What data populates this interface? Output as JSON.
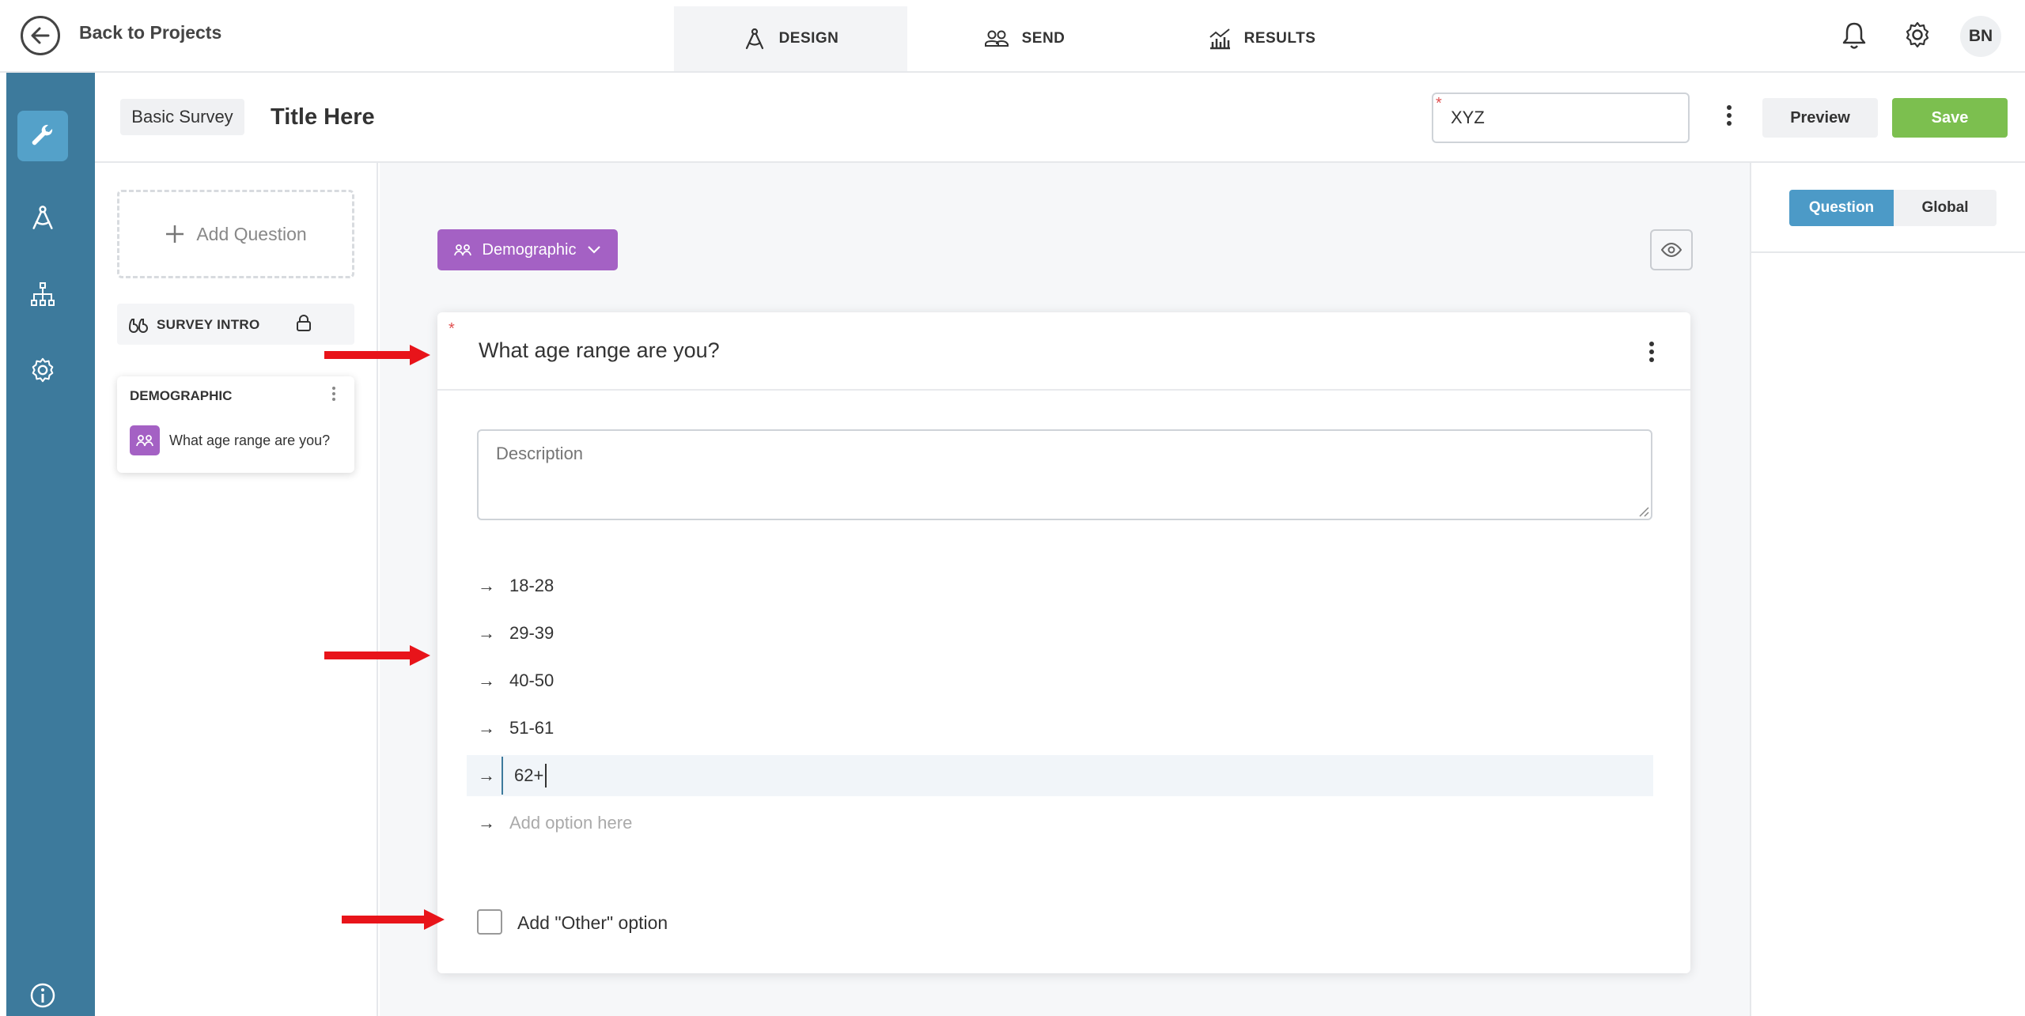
{
  "header": {
    "back_label": "Back to Projects",
    "tabs": [
      {
        "label": "DESIGN",
        "icon": "compass-icon",
        "active": true
      },
      {
        "label": "SEND",
        "icon": "users-icon",
        "active": false
      },
      {
        "label": "RESULTS",
        "icon": "chart-icon",
        "active": false
      }
    ],
    "avatar_initials": "BN"
  },
  "rail": {
    "items": [
      "wrench-icon",
      "compass-icon",
      "sitemap-icon",
      "gear-icon"
    ],
    "bottom": "info-icon",
    "active": "wrench-icon"
  },
  "subheader": {
    "survey_type": "Basic Survey",
    "title": "Title Here",
    "code_value": "XYZ",
    "code_required_mark": "*",
    "preview_label": "Preview",
    "save_label": "Save"
  },
  "question_list": {
    "add_question_label": "Add Question",
    "intro_label": "SURVEY INTRO",
    "section_title": "DEMOGRAPHIC",
    "questions": [
      "What age range are you?"
    ]
  },
  "editor": {
    "category_label": "Demographic",
    "required_mark": "*",
    "question_title": "What age range are you?",
    "description_placeholder": "Description",
    "options": [
      "18-28",
      "29-39",
      "40-50",
      "51-61",
      "62+"
    ],
    "add_option_placeholder": "Add option here",
    "arrow_glyph": "→",
    "other_option_label": "Add \"Other\" option",
    "other_option_checked": false
  },
  "settings_panel": {
    "tabs": [
      {
        "label": "Question",
        "active": true
      },
      {
        "label": "Global",
        "active": false
      }
    ]
  },
  "colors": {
    "rail": "#3d7a9c",
    "rail_active": "#54a1c9",
    "accent_purple": "#a461c4",
    "save_green": "#7cbf4f",
    "tab_blue": "#4c9ac7",
    "annotation_red": "#e8141a"
  }
}
